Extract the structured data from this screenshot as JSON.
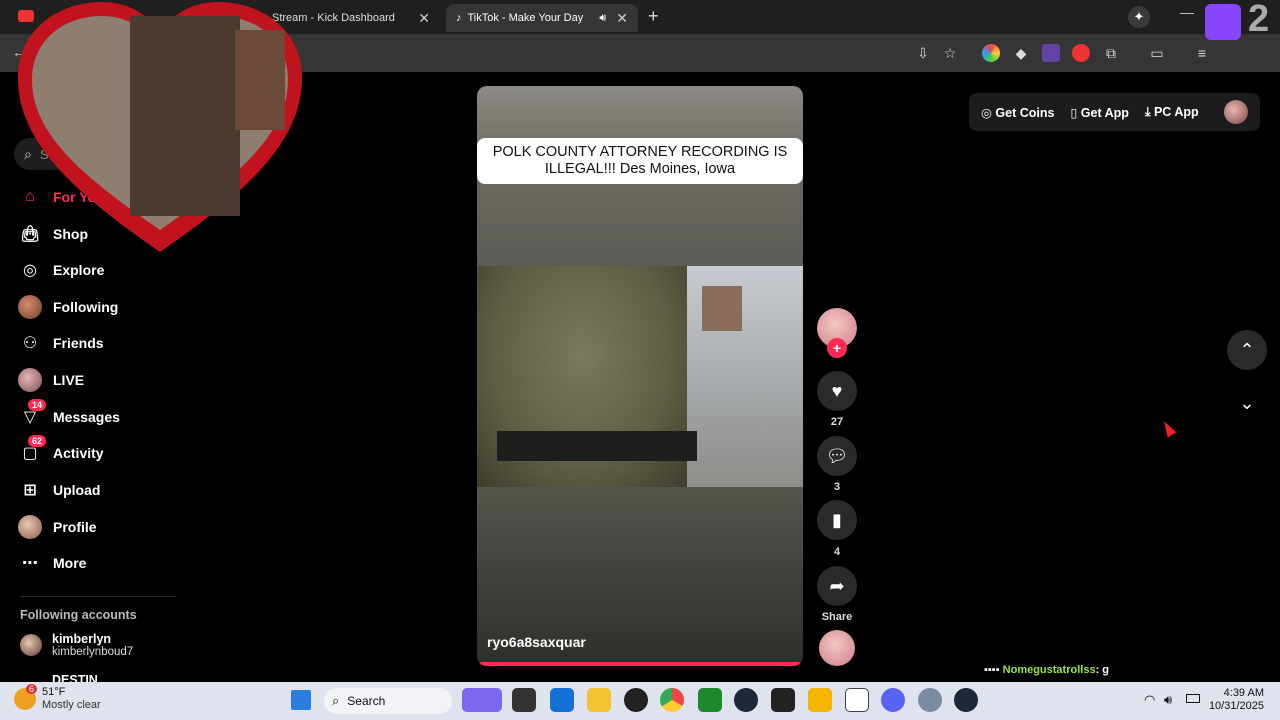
{
  "browser": {
    "tabs": [
      {
        "label": "Stream - Kick Dashboard",
        "active": false
      },
      {
        "label": "TikTok - Make Your Day",
        "active": true
      }
    ],
    "twitch_count": "2"
  },
  "sidebar": {
    "search_placeholder": "S",
    "items": [
      {
        "label": "For You",
        "icon": "home-icon",
        "active": true
      },
      {
        "label": "Shop",
        "icon": "shop-bag-icon"
      },
      {
        "label": "Explore",
        "icon": "compass-icon"
      },
      {
        "label": "Following",
        "icon": "following-avatar-icon"
      },
      {
        "label": "Friends",
        "icon": "friends-icon"
      },
      {
        "label": "LIVE",
        "icon": "live-avatar-icon"
      },
      {
        "label": "Messages",
        "icon": "messages-icon",
        "badge": "14"
      },
      {
        "label": "Activity",
        "icon": "activity-icon",
        "badge": "62"
      },
      {
        "label": "Upload",
        "icon": "upload-icon"
      },
      {
        "label": "Profile",
        "icon": "profile-avatar-icon"
      },
      {
        "label": "More",
        "icon": "more-dots-icon"
      }
    ],
    "following_header": "Following accounts",
    "following": [
      {
        "name": "kimberlyn",
        "handle": "kimberlynboud7"
      },
      {
        "name": "DESTIN",
        "handle": ""
      }
    ]
  },
  "topbar": {
    "get_coins": "Get Coins",
    "get_app": "Get App",
    "pc_app": "PC App"
  },
  "video": {
    "caption": "POLK COUNTY ATTORNEY RECORDING IS ILLEGAL!!!  Des Moines, Iowa",
    "author": "ryo6a8saxquar"
  },
  "actions": {
    "likes": "27",
    "comments": "3",
    "saves": "4",
    "share_label": "Share"
  },
  "chat": {
    "user": "Nomegustatrollss",
    "message": ": g"
  },
  "taskbar": {
    "weather_temp": "51°F",
    "weather_desc": "Mostly clear",
    "weather_badge": "6",
    "search_label": "Search",
    "time": "4:39 AM",
    "date": "10/31/2025"
  }
}
